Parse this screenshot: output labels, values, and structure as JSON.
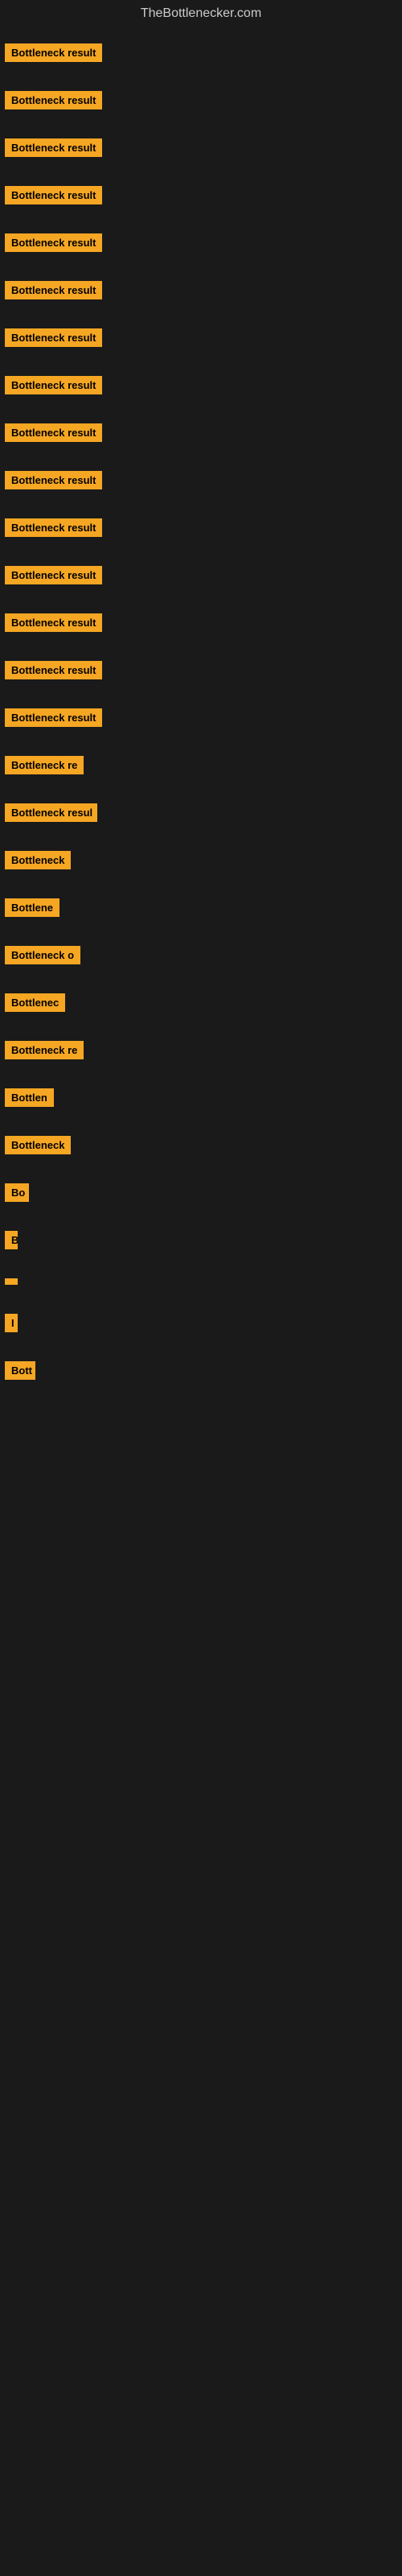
{
  "site": {
    "title": "TheBottlenecker.com"
  },
  "items": [
    {
      "label": "Bottleneck result",
      "width": 130,
      "margin_top": 8
    },
    {
      "label": "Bottleneck result",
      "width": 130,
      "margin_top": 20
    },
    {
      "label": "Bottleneck result",
      "width": 130,
      "margin_top": 20
    },
    {
      "label": "Bottleneck result",
      "width": 130,
      "margin_top": 20
    },
    {
      "label": "Bottleneck result",
      "width": 130,
      "margin_top": 20
    },
    {
      "label": "Bottleneck result",
      "width": 130,
      "margin_top": 20
    },
    {
      "label": "Bottleneck result",
      "width": 130,
      "margin_top": 20
    },
    {
      "label": "Bottleneck result",
      "width": 130,
      "margin_top": 20
    },
    {
      "label": "Bottleneck result",
      "width": 130,
      "margin_top": 20
    },
    {
      "label": "Bottleneck result",
      "width": 130,
      "margin_top": 20
    },
    {
      "label": "Bottleneck result",
      "width": 130,
      "margin_top": 20
    },
    {
      "label": "Bottleneck result",
      "width": 130,
      "margin_top": 20
    },
    {
      "label": "Bottleneck result",
      "width": 130,
      "margin_top": 20
    },
    {
      "label": "Bottleneck result",
      "width": 130,
      "margin_top": 20
    },
    {
      "label": "Bottleneck result",
      "width": 130,
      "margin_top": 20
    },
    {
      "label": "Bottleneck re",
      "width": 110,
      "margin_top": 20
    },
    {
      "label": "Bottleneck resul",
      "width": 115,
      "margin_top": 20
    },
    {
      "label": "Bottleneck",
      "width": 90,
      "margin_top": 20
    },
    {
      "label": "Bottlene",
      "width": 78,
      "margin_top": 20
    },
    {
      "label": "Bottleneck o",
      "width": 100,
      "margin_top": 20
    },
    {
      "label": "Bottlenec",
      "width": 82,
      "margin_top": 20
    },
    {
      "label": "Bottleneck re",
      "width": 108,
      "margin_top": 20
    },
    {
      "label": "Bottlen",
      "width": 72,
      "margin_top": 20
    },
    {
      "label": "Bottleneck",
      "width": 88,
      "margin_top": 20
    },
    {
      "label": "Bo",
      "width": 30,
      "margin_top": 20
    },
    {
      "label": "B",
      "width": 16,
      "margin_top": 20
    },
    {
      "label": "",
      "width": 10,
      "margin_top": 20
    },
    {
      "label": "I",
      "width": 8,
      "margin_top": 20
    },
    {
      "label": "Bott",
      "width": 38,
      "margin_top": 20
    }
  ]
}
